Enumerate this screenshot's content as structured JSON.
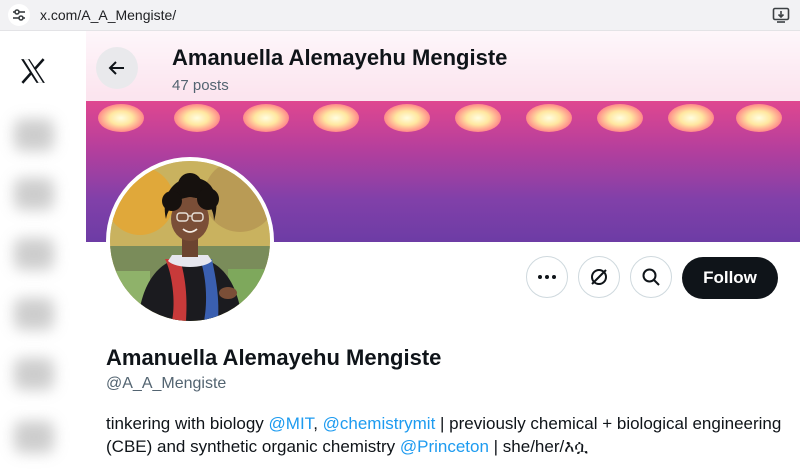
{
  "browser": {
    "url": "x.com/A_A_Mengiste/",
    "site_info_icon": "tune-icon",
    "install_icon": "install-app-icon"
  },
  "nav": {
    "logo": "x-logo-icon"
  },
  "header": {
    "name": "Amanuella Alemayehu Mengiste",
    "posts": "47 posts",
    "back_icon": "arrow-left-icon"
  },
  "profile": {
    "display_name": "Amanuella Alemayehu Mengiste",
    "handle": "@A_A_Mengiste",
    "bio": {
      "p1": "tinkering with biology ",
      "m1": "@MIT",
      "p2": ", ",
      "m2": "@chemistrymit",
      "p3": " | previously chemical + biological engineering (CBE) and synthetic organic chemistry ",
      "m3": "@Princeton",
      "p4": " | she/her/እሷ"
    }
  },
  "actions": {
    "more_icon": "more-icon",
    "grok_icon": "grok-icon",
    "search_icon": "search-icon",
    "follow_label": "Follow"
  },
  "colors": {
    "accent": "#1d9bf0",
    "follow_bg": "#0f1419",
    "banner_top": "#f3c0dd",
    "banner_bottom": "#6d3ca5"
  }
}
